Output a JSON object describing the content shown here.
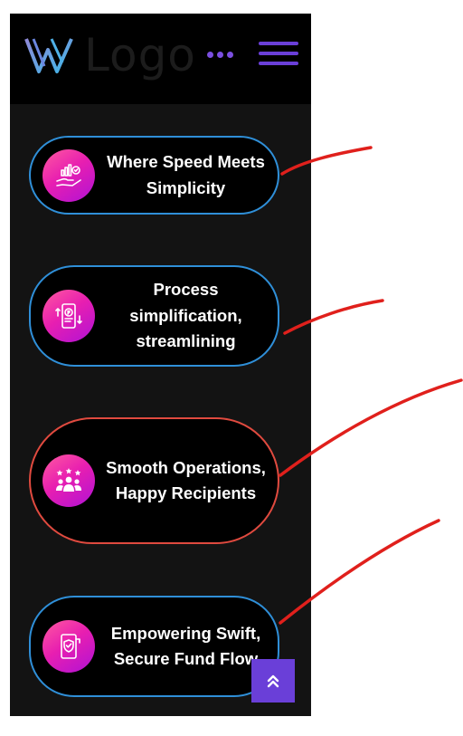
{
  "header": {
    "logo_text": "Logo",
    "menu_icon": "hamburger-menu-icon"
  },
  "cards": [
    {
      "label": "Where Speed Meets Simplicity",
      "icon": "hand-growth-chart-icon"
    },
    {
      "label": "Process simplification, streamlining",
      "icon": "mobile-payment-icon"
    },
    {
      "label": "Smooth Operations, Happy Recipients",
      "icon": "rated-team-icon"
    },
    {
      "label": "Empowering Swift, Secure Fund Flow",
      "icon": "secure-phone-icon"
    }
  ],
  "scroll_top": {
    "icon": "double-chevron-up-icon"
  },
  "colors": {
    "accent": "#6a3fd8",
    "card_border_blue": "#2f8fd8",
    "card_border_red": "#e04a3f",
    "annotation": "#e0201c",
    "icon_gradient_start": "#ff5aa0",
    "icon_gradient_end": "#b012d6"
  }
}
